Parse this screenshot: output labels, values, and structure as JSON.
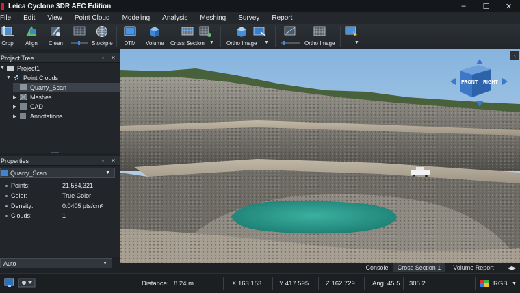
{
  "window": {
    "title": "Leica Cyclone 3DR AEC Edition"
  },
  "menu": [
    "File",
    "Edit",
    "View",
    "Point Cloud",
    "Modeling",
    "Analysis",
    "Meshing",
    "Survey",
    "Report"
  ],
  "toolbar": {
    "crop": "Crop",
    "align": "Align",
    "clean": "Clean",
    "stockpile": "Stockple",
    "dtm": "DTM",
    "volume": "Volume",
    "cross_section": "Cross Section",
    "ortho_image_1": "Ortho Image",
    "ortho_image_2": "Ortho Image"
  },
  "project_tree": {
    "title": "Project Tree",
    "root": "Project1",
    "point_clouds": "Point Clouds",
    "quarry_scan": "Quarry_Scan",
    "meshes": "Meshes",
    "cad": "CAD",
    "annotations": "Annotations"
  },
  "properties": {
    "title": "Properties",
    "selected": "Quarry_Scan",
    "rows": [
      {
        "key": "Points:",
        "value": "21,584,321"
      },
      {
        "key": "Color:",
        "value": "True Color"
      },
      {
        "key": "Density:",
        "value": "0.0405 pts/cm²"
      },
      {
        "key": "Clouds:",
        "value": "1"
      }
    ]
  },
  "render_mode": "Auto",
  "nav_cube": {
    "front": "FRONT",
    "right": "RIGHT"
  },
  "viewport_tabs": [
    "Console",
    "Cross Section 1",
    "Volume Report"
  ],
  "status": {
    "distance_label": "Distance:",
    "distance_value": "8.24 m",
    "x": "X  163.153",
    "y": "Y  417.595",
    "z": "Z  162.729",
    "ang_label": "Ang",
    "ang_value": "45.5",
    "ang_value2": "305.2",
    "color_mode": "RGB"
  },
  "colors": {
    "accent": "#d2232a",
    "panel_bg": "#22262a",
    "toolbar_bg": "#2b3035",
    "sky_top": "#8fb8df",
    "water": "#2a9a8e",
    "nav_cube": "#3d78c6"
  }
}
